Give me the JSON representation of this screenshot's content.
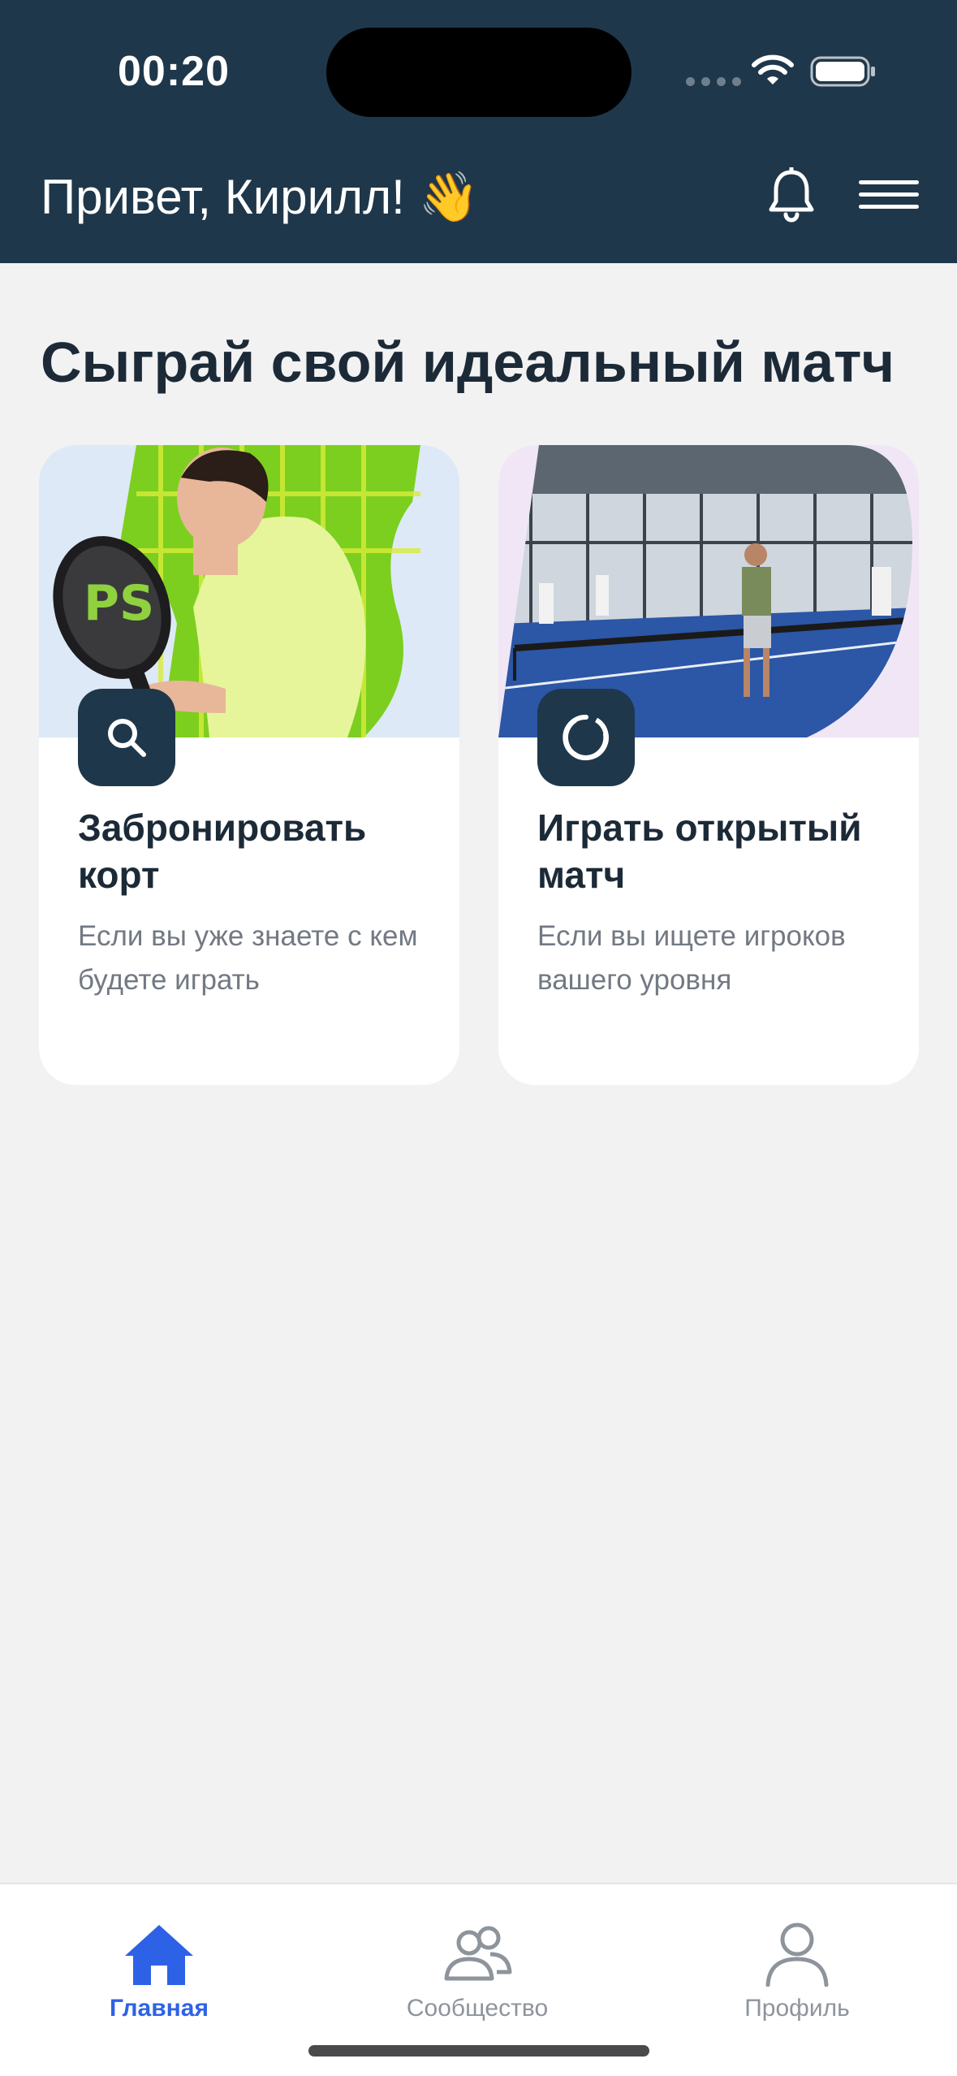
{
  "status_bar": {
    "time": "00:20",
    "wifi_icon": "wifi-icon",
    "battery_icon": "battery-icon"
  },
  "header": {
    "greeting": "Привет, Кирилл! 👋",
    "bell_icon": "bell-icon",
    "menu_icon": "hamburger-menu-icon",
    "background": "#1f374a"
  },
  "main": {
    "title": "Сыграй свой идеальный матч",
    "cards": [
      {
        "title": "Забронировать корт",
        "description": "Если вы уже знаете с кем будете играть",
        "icon": "search-icon",
        "image": "padel-player-photo"
      },
      {
        "title": "Играть открытый матч",
        "description": "Если вы ищете игроков вашего уровня",
        "icon": "refresh-circle-icon",
        "image": "padel-court-photo"
      }
    ]
  },
  "bottom_nav": {
    "items": [
      {
        "label": "Главная",
        "icon": "home-icon",
        "active": true
      },
      {
        "label": "Сообщество",
        "icon": "community-icon",
        "active": false
      },
      {
        "label": "Профиль",
        "icon": "profile-icon",
        "active": false
      }
    ],
    "active_color": "#2e62e6",
    "inactive_color": "#8e949c"
  }
}
